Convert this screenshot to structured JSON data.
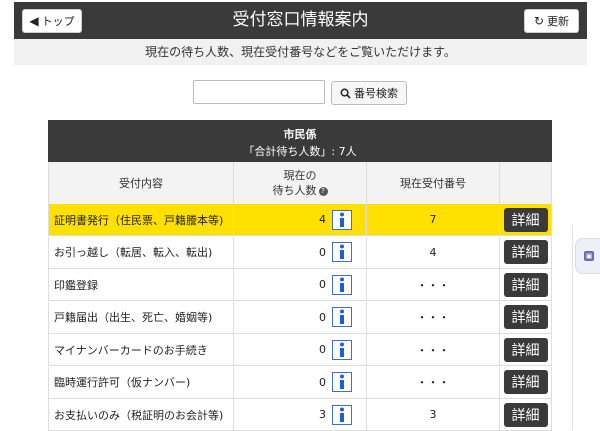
{
  "header": {
    "title": "受付窓口情報案内",
    "back_label": "トップ",
    "refresh_label": "更新"
  },
  "subtitle": "現在の待ち人数、現在受付番号などをご覧いただけます。",
  "search": {
    "value": "",
    "button_label": "番号検索"
  },
  "table": {
    "department": "市民係",
    "total_waiting": "「合計待ち人数」: 7人",
    "columns": {
      "content": "受付内容",
      "waiting_line1": "現在の",
      "waiting_line2": "待ち人数",
      "number": "現在受付番号"
    },
    "rows": [
      {
        "name": "証明書発行（住民票、戸籍謄本等)",
        "waiting": "4",
        "number": "7",
        "detail": "詳細"
      },
      {
        "name": "お引っ越し（転居、転入、転出)",
        "waiting": "0",
        "number": "4",
        "detail": "詳細"
      },
      {
        "name": "印鑑登録",
        "waiting": "0",
        "number": "・・・",
        "detail": "詳細"
      },
      {
        "name": "戸籍届出（出生、死亡、婚姻等)",
        "waiting": "0",
        "number": "・・・",
        "detail": "詳細"
      },
      {
        "name": "マイナンバーカードのお手続き",
        "waiting": "0",
        "number": "・・・",
        "detail": "詳細"
      },
      {
        "name": "臨時運行許可（仮ナンバー)",
        "waiting": "0",
        "number": "・・・",
        "detail": "詳細"
      },
      {
        "name": "お支払いのみ（税証明のお会計等)",
        "waiting": "3",
        "number": "3",
        "detail": "詳細"
      }
    ]
  },
  "colors": {
    "header_bg": "#3a3a3a",
    "highlight": "#ffe000",
    "info_icon": "#1f5fd6"
  }
}
